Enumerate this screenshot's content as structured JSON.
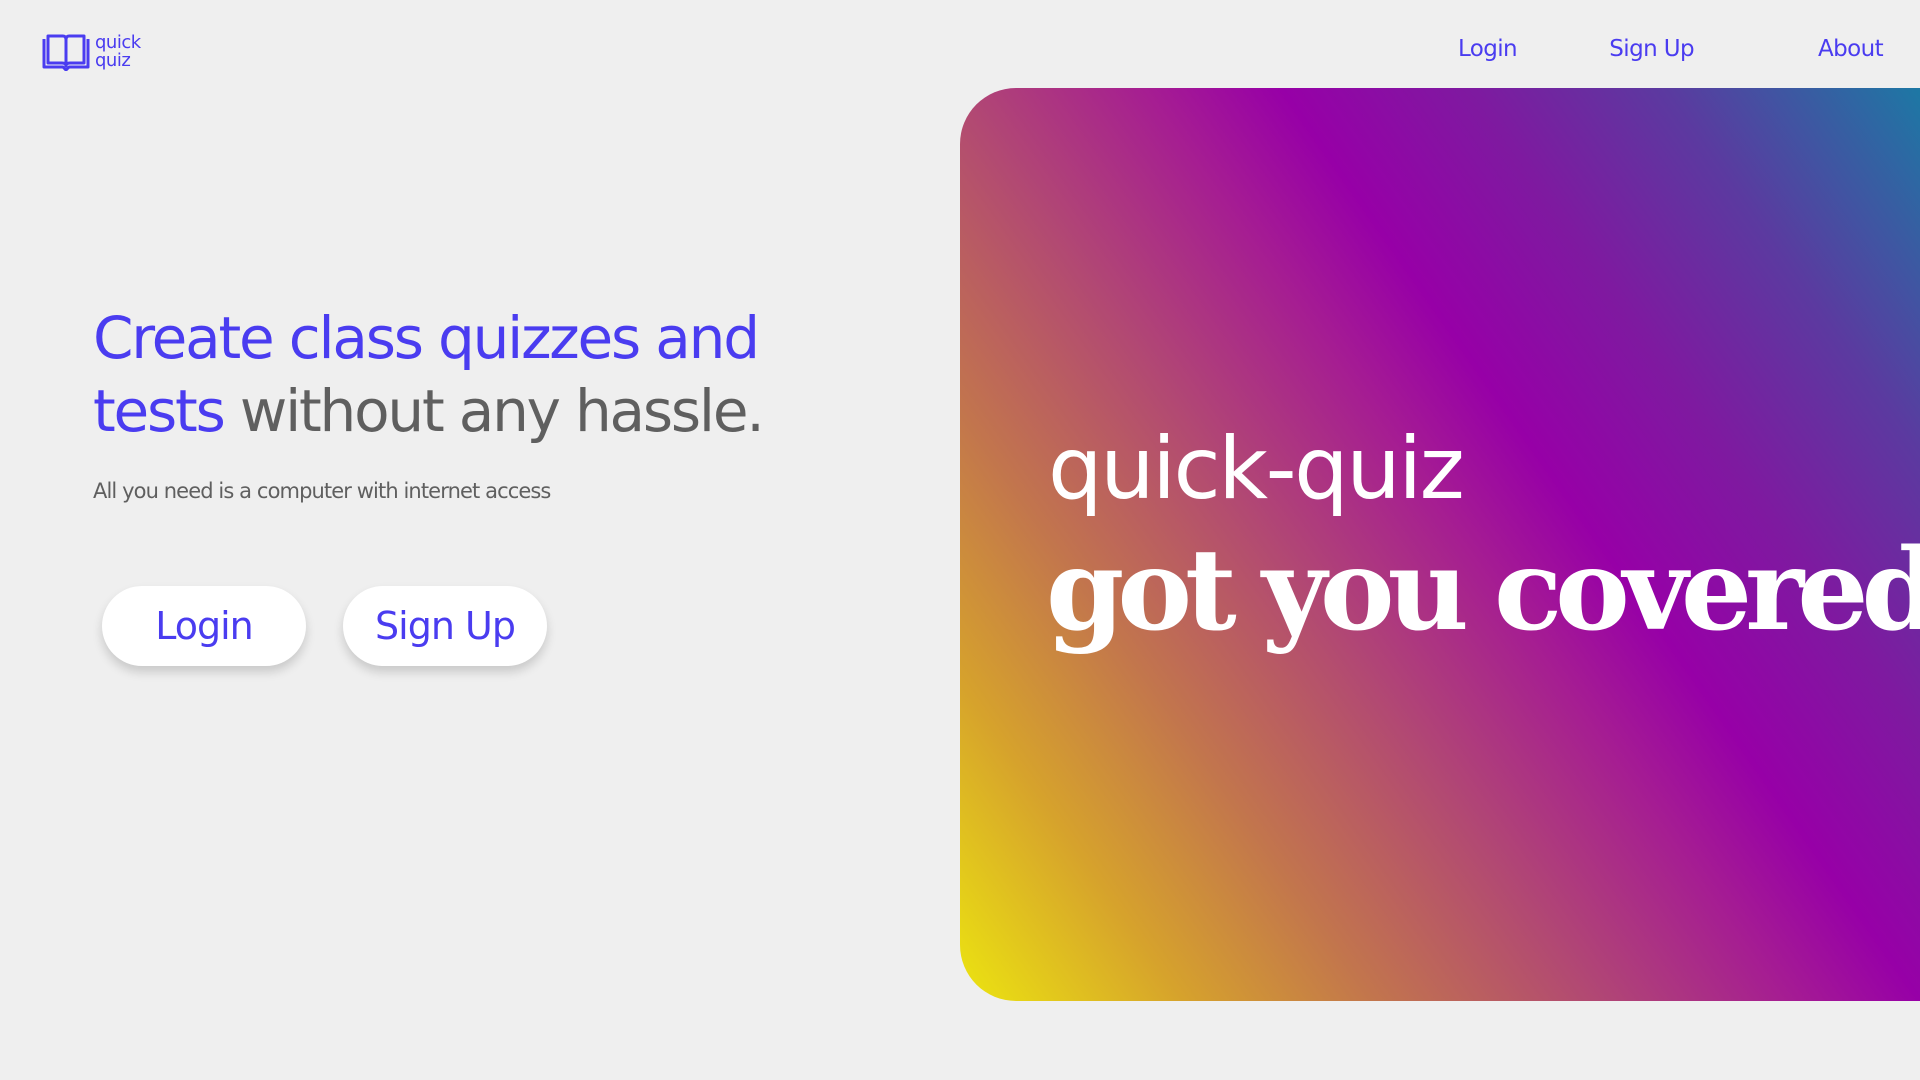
{
  "header": {
    "logo": {
      "icon": "open-book-icon",
      "line1": "quick",
      "line2": "quiz"
    },
    "nav": {
      "login": "Login",
      "signup": "Sign Up",
      "about": "About"
    }
  },
  "hero": {
    "headline_accent": "Create class quizzes and tests",
    "headline_rest": " without any hassle.",
    "subheadline": "All you need is a computer with internet access",
    "buttons": {
      "login": "Login",
      "signup": "Sign Up"
    }
  },
  "card": {
    "brand": "quick-quiz",
    "tagline": "got you covered"
  },
  "colors": {
    "accent": "#4a3cf0",
    "background": "#efefef",
    "body_text": "#5f5f5f",
    "gradient": [
      "#ece510",
      "#c2754d",
      "#9700a7",
      "#1d78a4"
    ]
  }
}
